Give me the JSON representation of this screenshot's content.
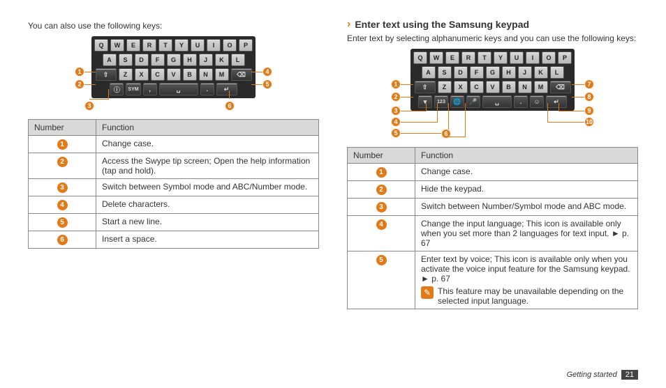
{
  "left": {
    "intro": "You can also use the following keys:",
    "headers": {
      "num": "Number",
      "func": "Function"
    },
    "rows": [
      {
        "n": "1",
        "f": "Change case."
      },
      {
        "n": "2",
        "f": "Access the Swype tip screen; Open the help information (tap and hold)."
      },
      {
        "n": "3",
        "f": "Switch between Symbol mode and ABC/Number mode."
      },
      {
        "n": "4",
        "f": "Delete characters."
      },
      {
        "n": "5",
        "f": "Start a new line."
      },
      {
        "n": "6",
        "f": "Insert a space."
      }
    ],
    "callouts": [
      "1",
      "2",
      "3",
      "4",
      "5",
      "6"
    ]
  },
  "right": {
    "heading": "Enter text using the Samsung keypad",
    "intro": "Enter text by selecting alphanumeric keys and you can use the following keys:",
    "headers": {
      "num": "Number",
      "func": "Function"
    },
    "rows": [
      {
        "n": "1",
        "f": "Change case."
      },
      {
        "n": "2",
        "f": "Hide the keypad."
      },
      {
        "n": "3",
        "f": "Switch between Number/Symbol mode and ABC mode."
      },
      {
        "n": "4",
        "f": "Change the input language; This icon is available only when you set more than 2 languages for text input. ► p. 67"
      },
      {
        "n": "5",
        "f": "Enter text by voice; This icon is available only when you activate the voice input feature for the Samsung keypad. ► p. 67",
        "note": "This feature may be unavailable depending on the selected input language."
      }
    ],
    "callouts": [
      "1",
      "2",
      "3",
      "4",
      "5",
      "6",
      "7",
      "8",
      "9",
      "10"
    ]
  },
  "footer": {
    "section": "Getting started",
    "page": "21"
  },
  "keys": {
    "row1": [
      "Q",
      "W",
      "E",
      "R",
      "T",
      "Y",
      "U",
      "I",
      "O",
      "P"
    ],
    "row2": [
      "A",
      "S",
      "D",
      "F",
      "G",
      "H",
      "J",
      "K",
      "L"
    ],
    "row3": [
      "Z",
      "X",
      "C",
      "V",
      "B",
      "N",
      "M"
    ]
  }
}
